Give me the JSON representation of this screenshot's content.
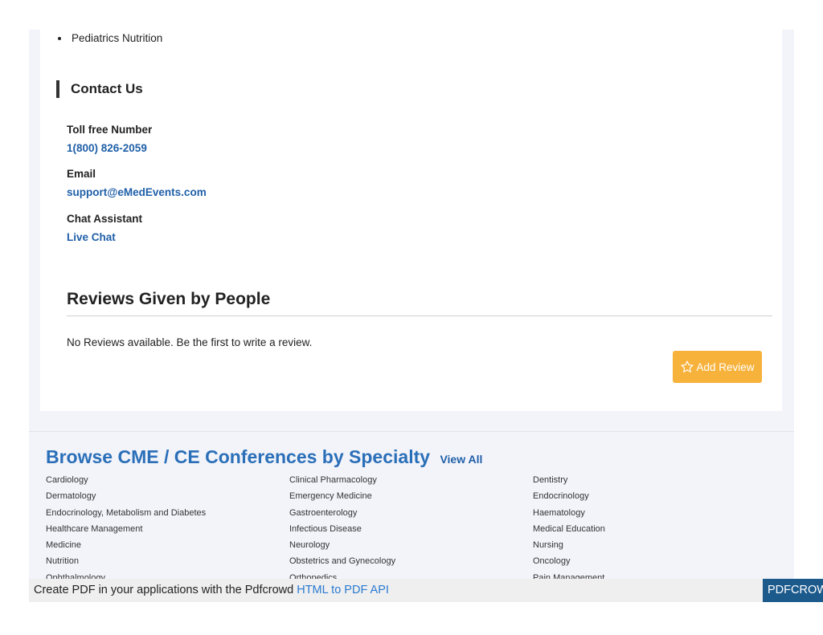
{
  "specializations": {
    "items": [
      "Pediatrics Nutrition"
    ]
  },
  "contact": {
    "heading": "Contact Us",
    "toll_free_label": "Toll free Number",
    "toll_free_value": "1(800) 826-2059",
    "email_label": "Email",
    "email_value": "support@eMedEvents.com",
    "chat_label": "Chat Assistant",
    "chat_value": "Live Chat"
  },
  "reviews": {
    "title": "Reviews Given by People",
    "empty_text": "No Reviews available. Be the first to write a review.",
    "add_button_label": "Add Review",
    "add_button_icon": "star-outline-icon",
    "button_color": "#f7b23b"
  },
  "browse": {
    "title": "Browse CME / CE Conferences by Specialty",
    "view_all": "View All",
    "title_color": "#2a6fb8",
    "columns": [
      [
        "Cardiology",
        "Dermatology",
        "Endocrinology, Metabolism and Diabetes",
        "Healthcare Management",
        "Medicine",
        "Nutrition",
        "Ophthalmology"
      ],
      [
        "Clinical Pharmacology",
        "Emergency Medicine",
        "Gastroenterology",
        "Infectious Disease",
        "Neurology",
        "Obstetrics and Gynecology",
        "Orthopedics"
      ],
      [
        "Dentistry",
        "Endocrinology",
        "Haematology",
        "Medical Education",
        "Nursing",
        "Oncology",
        "Pain Management"
      ]
    ]
  },
  "pdf_banner": {
    "text": "Create PDF in your applications with the Pdfcrowd",
    "link_text": "HTML to PDF API",
    "brand": "PDFCROWD"
  }
}
